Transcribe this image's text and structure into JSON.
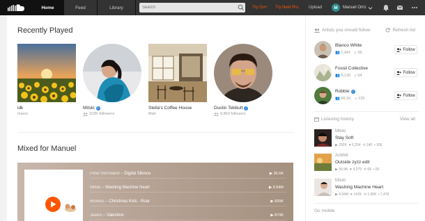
{
  "header": {
    "tabs": [
      {
        "label": "Home",
        "active": true
      },
      {
        "label": "Feed",
        "active": false
      },
      {
        "label": "Library",
        "active": false
      }
    ],
    "search_placeholder": "Search",
    "try_go": "Try Go+",
    "try_next_pro": "Try Next Pro",
    "upload": "Upload",
    "user_initial": "M",
    "user_name": "Manuel Orrù",
    "accent": "#ff5500"
  },
  "recently_played": {
    "title": "Recently Played",
    "items": [
      {
        "title": "idk",
        "subtitle": "marco",
        "round": false,
        "verified": false
      },
      {
        "title": "Mitski",
        "subtitle": "102K followers",
        "round": true,
        "verified": true
      },
      {
        "title": "Stella's Coffee House",
        "subtitle": "Mah",
        "round": false,
        "verified": false
      },
      {
        "title": "Dustin Tebbutt",
        "subtitle": "9,863 followers",
        "round": true,
        "verified": true
      }
    ]
  },
  "mixed": {
    "title": "Mixed for Manuel",
    "tracks": [
      {
        "artist": "Peter McPoland",
        "title": "Digital Silence",
        "count": "36.5K"
      },
      {
        "artist": "Mitski",
        "title": "Washing Machine Heart",
        "count": "9.94M"
      },
      {
        "artist": "Boxkiss",
        "title": "Christmas Kids - Roar",
        "count": "609K"
      },
      {
        "artist": "Jealov",
        "title": "Valentine",
        "count": "874K"
      }
    ]
  },
  "sidebar": {
    "artists_header": "Artists you should follow",
    "refresh": "Refresh list",
    "follow_label": "Follow",
    "artists": [
      {
        "name": "Blanco White",
        "followers": "1,441",
        "tracks": "36",
        "verified": false
      },
      {
        "name": "Fossil Collective",
        "followers": "5,136",
        "tracks": "54",
        "verified": false
      },
      {
        "name": "Robbie",
        "followers": "90.1K",
        "tracks": "129",
        "verified": true
      }
    ],
    "history_header": "Listening history",
    "view_all": "View all",
    "history": [
      {
        "artist": "Mitski",
        "title": "Stay Soft",
        "plays": "292K",
        "likes": "6,254",
        "reposts": "140",
        "comments": "306"
      },
      {
        "artist": "AsWell",
        "title": "Outside zyzz edit",
        "plays": "99.9K",
        "likes": "4,279",
        "reposts": "68",
        "comments": "55"
      },
      {
        "artist": "Mitski",
        "title": "Washing Machine Heart",
        "plays": "9.94M",
        "likes": "142K",
        "reposts": "1,968",
        "comments": "7,478"
      }
    ],
    "go_mobile": "Go mobile"
  }
}
